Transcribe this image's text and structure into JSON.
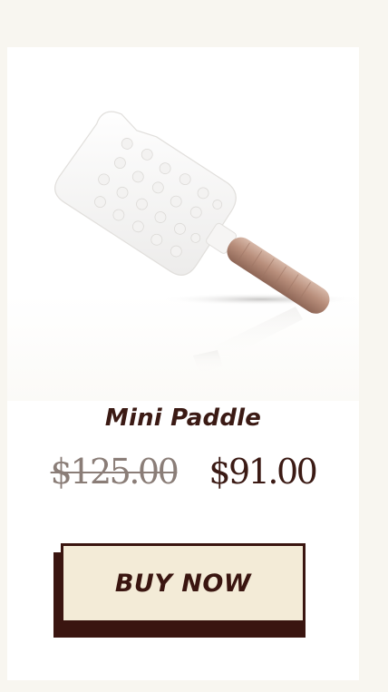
{
  "product": {
    "name": "Mini Paddle",
    "price_original": "$125.00",
    "price_sale": "$91.00",
    "image_icon": "paddle-brush-product-image"
  },
  "actions": {
    "buy_label": "BUY NOW"
  },
  "colors": {
    "page_background": "#f8f6f0",
    "card_background": "#ffffff",
    "text_dark": "#3b1a14",
    "price_strike": "#8a7d77",
    "button_fill": "#f3ebd7",
    "button_border": "#3a1510"
  }
}
